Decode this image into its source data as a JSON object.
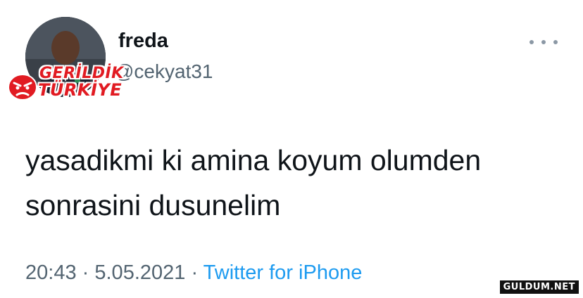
{
  "user": {
    "display_name": "freda",
    "handle": "@cekyat31",
    "avatar": "profile-photo"
  },
  "overlay_badge": {
    "line1": "GERİLDİK",
    "line2": "TÜRKİYE",
    "icon": "angry-face-icon"
  },
  "tweet": {
    "text": "yasadikmi ki amina koyum olumden sonrasini dusunelim",
    "time": "20:43",
    "date": "5.05.2021",
    "source": "Twitter for iPhone",
    "separator": "·"
  },
  "watermark": "GULDUM.NET",
  "colors": {
    "text": "#0f1419",
    "secondary": "#536471",
    "link": "#1d9bf0",
    "badge_red": "#e11b22"
  }
}
